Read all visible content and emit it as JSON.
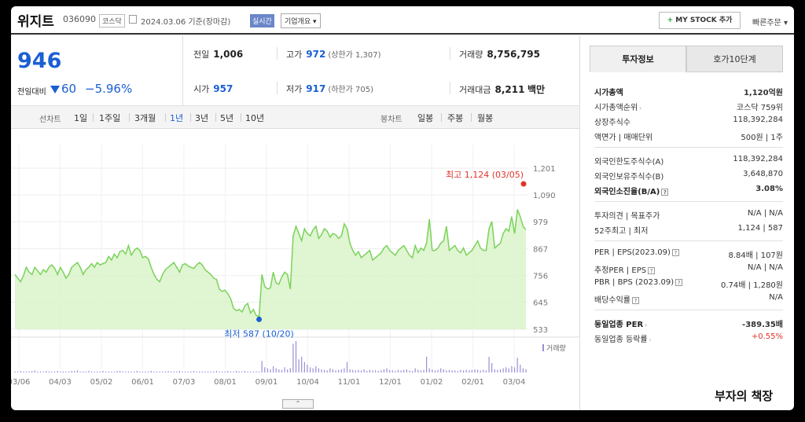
{
  "header": {
    "name": "위지트",
    "code": "036090",
    "market": "코스닥",
    "date": "2024.03.06 기준(장마감)",
    "realtime": "실시간",
    "overview": "기업개요 ▾",
    "mystock": "MY STOCK 추가",
    "mystock_plus": "+",
    "quick": "빠른주문 ▾"
  },
  "price": {
    "current": "946",
    "change_label": "전일대비",
    "change_value": "60",
    "change_pct": "−5.96%"
  },
  "stats": {
    "prev_label": "전일",
    "prev": "1,006",
    "high_label": "고가",
    "high": "972",
    "high_sub": "(상한가 1,307)",
    "volume_label": "거래량",
    "volume": "8,756,795",
    "open_label": "시가",
    "open": "957",
    "low_label": "저가",
    "low": "917",
    "low_sub": "(하한가 705)",
    "amount_label": "거래대금",
    "amount": "8,211",
    "amount_unit": "백만"
  },
  "period": {
    "line_label": "선차트",
    "line_items": [
      "1일",
      "1주일",
      "3개월",
      "1년",
      "3년",
      "5년",
      "10년"
    ],
    "active": "1년",
    "candle_label": "봉차트",
    "candle_items": [
      "일봉",
      "주봉",
      "월봉"
    ]
  },
  "chart_data": {
    "type": "area",
    "y_ticks": [
      1201,
      1090,
      979,
      867,
      756,
      645,
      533
    ],
    "x_ticks": [
      "03/06",
      "04/03",
      "05/02",
      "06/01",
      "07/03",
      "08/01",
      "09/01",
      "10/04",
      "11/01",
      "12/01",
      "01/02",
      "02/01",
      "03/04"
    ],
    "high_annotation": "최고 1,124 (03/05)",
    "low_annotation": "최저 587 (10/20)",
    "volume_label": "거래량",
    "ylim": [
      533,
      1201
    ],
    "line_color": "#7ad35a",
    "fill_color": "#d8f3c7",
    "high_color": "#e0342b",
    "low_color": "#1a5fd4",
    "values": [
      760,
      745,
      730,
      755,
      790,
      770,
      760,
      790,
      775,
      760,
      780,
      770,
      790,
      800,
      785,
      760,
      790,
      770,
      745,
      760,
      790,
      800,
      810,
      790,
      760,
      780,
      790,
      805,
      790,
      810,
      800,
      805,
      810,
      835,
      820,
      845,
      830,
      855,
      860,
      845,
      880,
      840,
      860,
      870,
      860,
      830,
      835,
      825,
      790,
      760,
      740,
      730,
      760,
      780,
      790,
      800,
      810,
      790,
      770,
      800,
      805,
      795,
      790,
      785,
      800,
      810,
      800,
      780,
      770,
      760,
      745,
      740,
      700,
      690,
      695,
      680,
      660,
      620,
      610,
      615,
      605,
      630,
      640,
      600,
      615,
      590,
      587,
      760,
      710,
      700,
      705,
      770,
      725,
      720,
      750,
      770,
      760,
      700,
      920,
      960,
      930,
      900,
      950,
      930,
      920,
      945,
      960,
      910,
      925,
      950,
      940,
      915,
      930,
      925,
      910,
      920,
      970,
      950,
      890,
      860,
      840,
      855,
      830,
      840,
      850,
      860,
      820,
      830,
      840,
      850,
      870,
      880,
      860,
      850,
      840,
      860,
      870,
      880,
      860,
      840,
      830,
      880,
      850,
      870,
      860,
      890,
      990,
      860,
      860,
      870,
      890,
      900,
      960,
      860,
      870,
      880,
      860,
      850,
      870,
      840,
      850,
      860,
      880,
      900,
      870,
      860,
      860,
      950,
      980,
      870,
      880,
      890,
      930,
      950,
      940,
      1000,
      930,
      1030,
      1000,
      960,
      946
    ],
    "volume_values": [
      2,
      2,
      3,
      2,
      2,
      2,
      3,
      4,
      2,
      2,
      2,
      3,
      2,
      2,
      2,
      3,
      2,
      2,
      2,
      2,
      3,
      3,
      4,
      2,
      2,
      2,
      3,
      2,
      2,
      2,
      2,
      3,
      2,
      2,
      2,
      2,
      3,
      3,
      2,
      2,
      2,
      2,
      2,
      3,
      2,
      2,
      2,
      2,
      3,
      2,
      2,
      2,
      2,
      2,
      3,
      2,
      2,
      2,
      3,
      2,
      2,
      2,
      2,
      3,
      2,
      2,
      2,
      2,
      2,
      2,
      2,
      3,
      2,
      2,
      2,
      3,
      2,
      2,
      3,
      2,
      2,
      3,
      2,
      2,
      2,
      2,
      2,
      22,
      10,
      8,
      6,
      12,
      8,
      6,
      5,
      10,
      6,
      8,
      55,
      60,
      25,
      30,
      20,
      15,
      10,
      8,
      12,
      8,
      6,
      5,
      4,
      8,
      6,
      4,
      5,
      6,
      8,
      20,
      6,
      5,
      4,
      5,
      4,
      6,
      3,
      5,
      4,
      4,
      3,
      4,
      6,
      8,
      5,
      4,
      3,
      5,
      4,
      5,
      6,
      4,
      3,
      8,
      5,
      4,
      5,
      30,
      8,
      6,
      4,
      5,
      8,
      6,
      4,
      5,
      4,
      4,
      3,
      5,
      4,
      5,
      4,
      5,
      6,
      5,
      4,
      5,
      4,
      30,
      18,
      6,
      5,
      6,
      8,
      10,
      8,
      12,
      10,
      28,
      15,
      8,
      6
    ]
  },
  "collapse": "⌃",
  "right_panel": {
    "tab_active": "투자정보",
    "tab_other": "호가10단계",
    "group1": [
      {
        "k": "시가총액",
        "v": "1,120억원",
        "bold": true
      },
      {
        "k": "시가총액순위",
        "v": "코스닥 759위",
        "chev": true
      },
      {
        "k": "상장주식수",
        "v": "118,392,284"
      },
      {
        "k": "액면가 | 매매단위",
        "v": "500원 | 1주"
      }
    ],
    "group2": [
      {
        "k": "외국인한도주식수(A)",
        "v": "118,392,284"
      },
      {
        "k": "외국인보유주식수(B)",
        "v": "3,648,870"
      },
      {
        "k": "외국인소진율(B/A)",
        "v": "3.08%",
        "bold": true,
        "q": true
      }
    ],
    "group3": [
      {
        "k": "투자의견 | 목표주가",
        "v": "N/A | N/A"
      },
      {
        "k": "52주최고 | 최저",
        "v": "1,124 | 587"
      }
    ],
    "group4": [
      {
        "k": "PER | EPS(2023.09)",
        "v": "8.84배 | 107원",
        "q": true
      },
      {
        "k": "추정PER | EPS",
        "v": "N/A | N/A",
        "q": true
      },
      {
        "k": "PBR | BPS (2023.09)",
        "v": "0.74배 | 1,280원",
        "q": true
      },
      {
        "k": "배당수익률",
        "v": "N/A",
        "q": true
      }
    ],
    "group5": [
      {
        "k": "동일업종 PER",
        "v": "-389.35배",
        "bold": true,
        "chev": true
      },
      {
        "k": "동일업종 등락률",
        "v": "+0.55%",
        "red": true,
        "chev": true
      }
    ]
  },
  "watermark": "부자의 책장"
}
